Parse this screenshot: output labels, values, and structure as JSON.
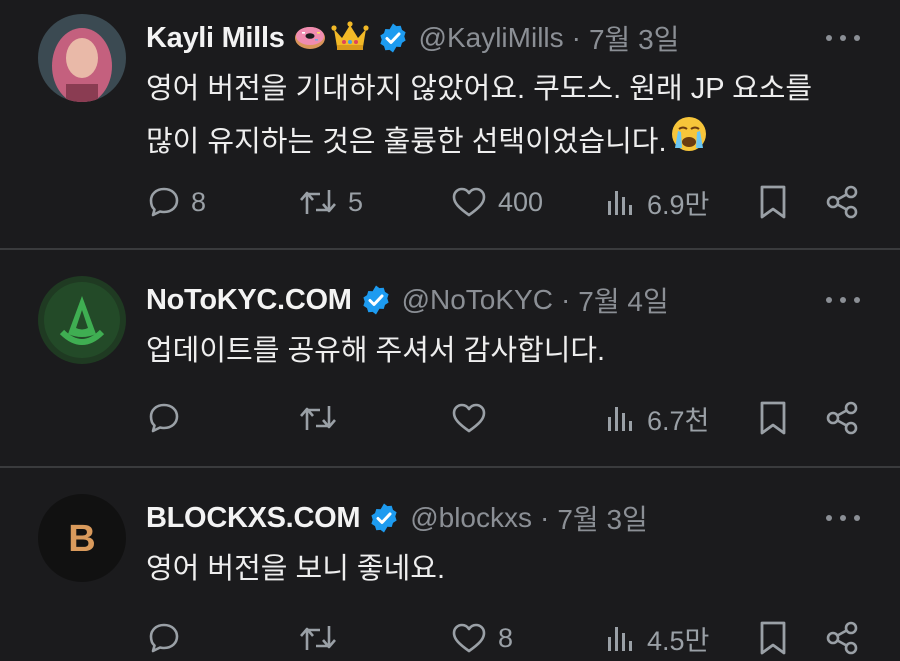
{
  "posts": [
    {
      "name": "Kayli Mills",
      "handle": "@KayliMills",
      "separator": "·",
      "date": "7월 3일",
      "text_lines": [
        "영어 버전을 기대하지 않았어요. 쿠도스. 원래 JP 요소를",
        "많이 유지하는 것은 훌륭한 선택이었습니다."
      ],
      "name_emojis": [
        "donut-emoji",
        "crown-emoji"
      ],
      "text_emoji": "crying-face-emoji",
      "replies": "8",
      "reposts": "5",
      "likes": "400",
      "views": "6.9만",
      "avatar_colors": {
        "bg": "#3b4a52",
        "hair": "#c4607e",
        "face": "#e9b9a8"
      }
    },
    {
      "name": "NoToKYC.COM",
      "handle": "@NoToKYC",
      "separator": "·",
      "date": "7월 4일",
      "text_lines": [
        "업데이트를 공유해 주셔서 감사합니다."
      ],
      "replies": "",
      "reposts": "",
      "likes": "",
      "views": "6.7천",
      "avatar_colors": {
        "bg": "#1f3a22",
        "logo": "#3fae52"
      }
    },
    {
      "name": "BLOCKXS.COM",
      "handle": "@blockxs",
      "separator": "·",
      "date": "7월 3일",
      "text_lines": [
        "영어 버전을 보니 좋네요."
      ],
      "replies": "",
      "reposts": "",
      "likes": "8",
      "views": "4.5만",
      "avatar_letter": "B",
      "avatar_colors": {
        "bg": "#111111",
        "letter": "#d99a5c"
      }
    }
  ],
  "colors": {
    "background": "#1b1b1d",
    "verified": "#1d9bf0",
    "muted": "#8b8f95",
    "divider": "#3a3b3d"
  }
}
